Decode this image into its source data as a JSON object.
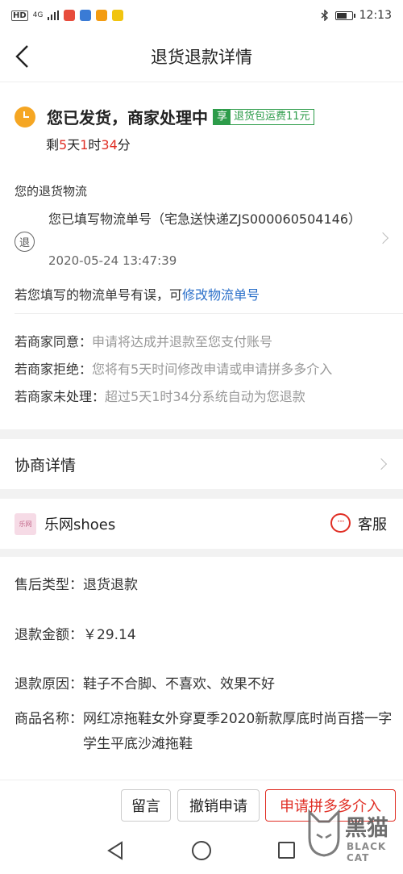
{
  "status_bar": {
    "network": "HD",
    "signal": "4G",
    "time": "12:13"
  },
  "nav": {
    "title": "退货退款详情"
  },
  "status": {
    "title": "您已发货，商家处理中",
    "promo_key": "享",
    "promo_text": "退货包运费11元",
    "countdown_prefix": "剩",
    "countdown_days": "5",
    "countdown_days_unit": "天",
    "countdown_hours": "1",
    "countdown_hours_unit": "时",
    "countdown_minutes": "34",
    "countdown_minutes_unit": "分"
  },
  "logistics": {
    "label": "您的退货物流",
    "icon_text": "退",
    "text": "您已填写物流单号（宅急送快递ZJS000060504146）",
    "time": "2020-05-24 13:47:39",
    "modify_prefix": "若您填写的物流单号有误，可",
    "modify_link": "修改物流单号"
  },
  "rules": [
    {
      "label": "若商家同意：",
      "desc": "申请将达成并退款至您支付账号"
    },
    {
      "label": "若商家拒绝：",
      "desc": "您将有5天时间修改申请或申请拼多多介入"
    },
    {
      "label": "若商家未处理：",
      "desc": "超过5天1时34分系统自动为您退款"
    }
  ],
  "negotiation": {
    "label": "协商详情"
  },
  "shop": {
    "logo_text": "乐网",
    "name": "乐网shoes",
    "service_icon_text": "···",
    "service_label": "客服"
  },
  "info": {
    "type_label": "售后类型：",
    "type_value": "退货退款",
    "amount_label": "退款金额：",
    "amount_value": "￥29.14",
    "reason_label": "退款原因：",
    "reason_value": "鞋子不合脚、不喜欢、效果不好",
    "product_label": "商品名称：",
    "product_value": "网红凉拖鞋女外穿夏季2020新款厚底时尚百搭一字学生平底沙滩拖鞋"
  },
  "actions": {
    "message": "留言",
    "cancel": "撤销申请",
    "intervene": "申请拼多多介入"
  },
  "watermark": {
    "text": "黑猫",
    "sub": "BLACK CAT"
  }
}
